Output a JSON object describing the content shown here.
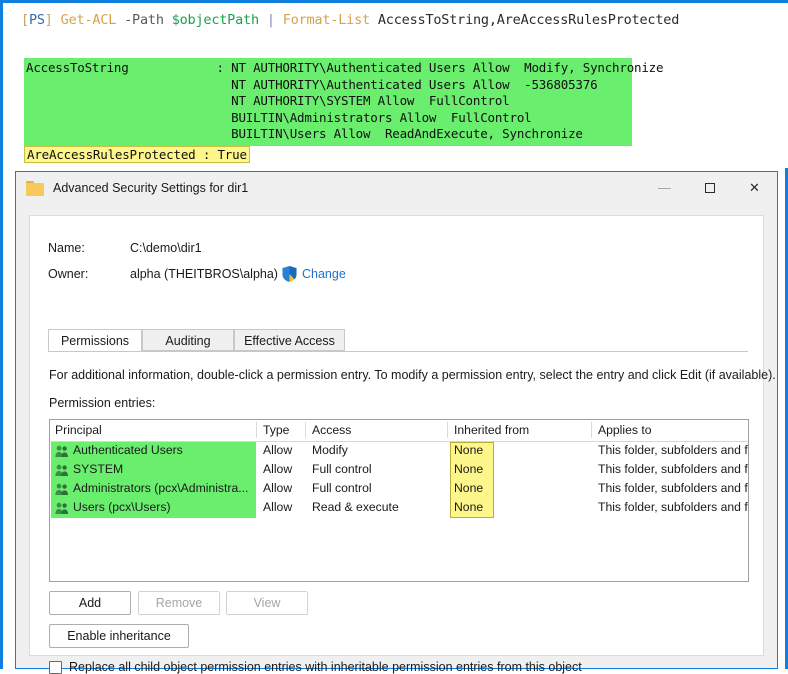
{
  "console": {
    "prompt_bracket_open": "[",
    "prompt_ps": "PS",
    "prompt_bracket_close": "]",
    "command": "Get-ACL",
    "param": "-Path",
    "variable": "$objectPath",
    "pipe": "|",
    "command2": "Format-List",
    "args": "AccessToString,AreAccessRulesProtected",
    "output_block": "AccessToString            : NT AUTHORITY\\Authenticated Users Allow  Modify, Synchronize\n                            NT AUTHORITY\\Authenticated Users Allow  -536805376\n                            NT AUTHORITY\\SYSTEM Allow  FullControl\n                            BUILTIN\\Administrators Allow  FullControl\n                            BUILTIN\\Users Allow  ReadAndExecute, Synchronize",
    "protected_line": "AreAccessRulesProtected : True",
    "output_highlight_color": "#6aee6e",
    "protected_highlight_color": "#fdf68a"
  },
  "dialog": {
    "title": "Advanced Security Settings for dir1",
    "icon": "folder-icon",
    "caption": {
      "minimize": "—",
      "maximize": "□",
      "close": "✕"
    },
    "fields": {
      "name_label": "Name:",
      "name_value": "C:\\demo\\dir1",
      "owner_label": "Owner:",
      "owner_value": "alpha (THEITBROS\\alpha)",
      "change_link": "Change"
    },
    "tabs": [
      {
        "label": "Permissions",
        "active": true
      },
      {
        "label": "Auditing",
        "active": false
      },
      {
        "label": "Effective Access",
        "active": false
      }
    ],
    "info_text": "For additional information, double-click a permission entry. To modify a permission entry, select the entry and click Edit (if available).",
    "entries_label": "Permission entries:",
    "table": {
      "columns": [
        "Principal",
        "Type",
        "Access",
        "Inherited from",
        "Applies to"
      ],
      "rows": [
        {
          "principal": "Authenticated Users",
          "type": "Allow",
          "access": "Modify",
          "inherited_from": "None",
          "applies_to": "This folder, subfolders and files"
        },
        {
          "principal": "SYSTEM",
          "type": "Allow",
          "access": "Full control",
          "inherited_from": "None",
          "applies_to": "This folder, subfolders and files"
        },
        {
          "principal": "Administrators (pcx\\Administra...",
          "type": "Allow",
          "access": "Full control",
          "inherited_from": "None",
          "applies_to": "This folder, subfolders and files"
        },
        {
          "principal": "Users (pcx\\Users)",
          "type": "Allow",
          "access": "Read & execute",
          "inherited_from": "None",
          "applies_to": "This folder, subfolders and files"
        }
      ],
      "principal_highlight_color": "#6aee6e",
      "inherited_highlight_color": "#fdf68a"
    },
    "buttons": {
      "add": "Add",
      "remove": "Remove",
      "view": "View",
      "enable_inheritance": "Enable inheritance"
    },
    "replace_checkbox": {
      "label": "Replace all child object permission entries with inheritable permission entries from this object",
      "checked": false
    }
  },
  "colors": {
    "accent_blue": "#0f7fe0",
    "link_blue": "#1f6fd0",
    "highlight_green": "#6aee6e",
    "highlight_yellow": "#fdf68a"
  }
}
